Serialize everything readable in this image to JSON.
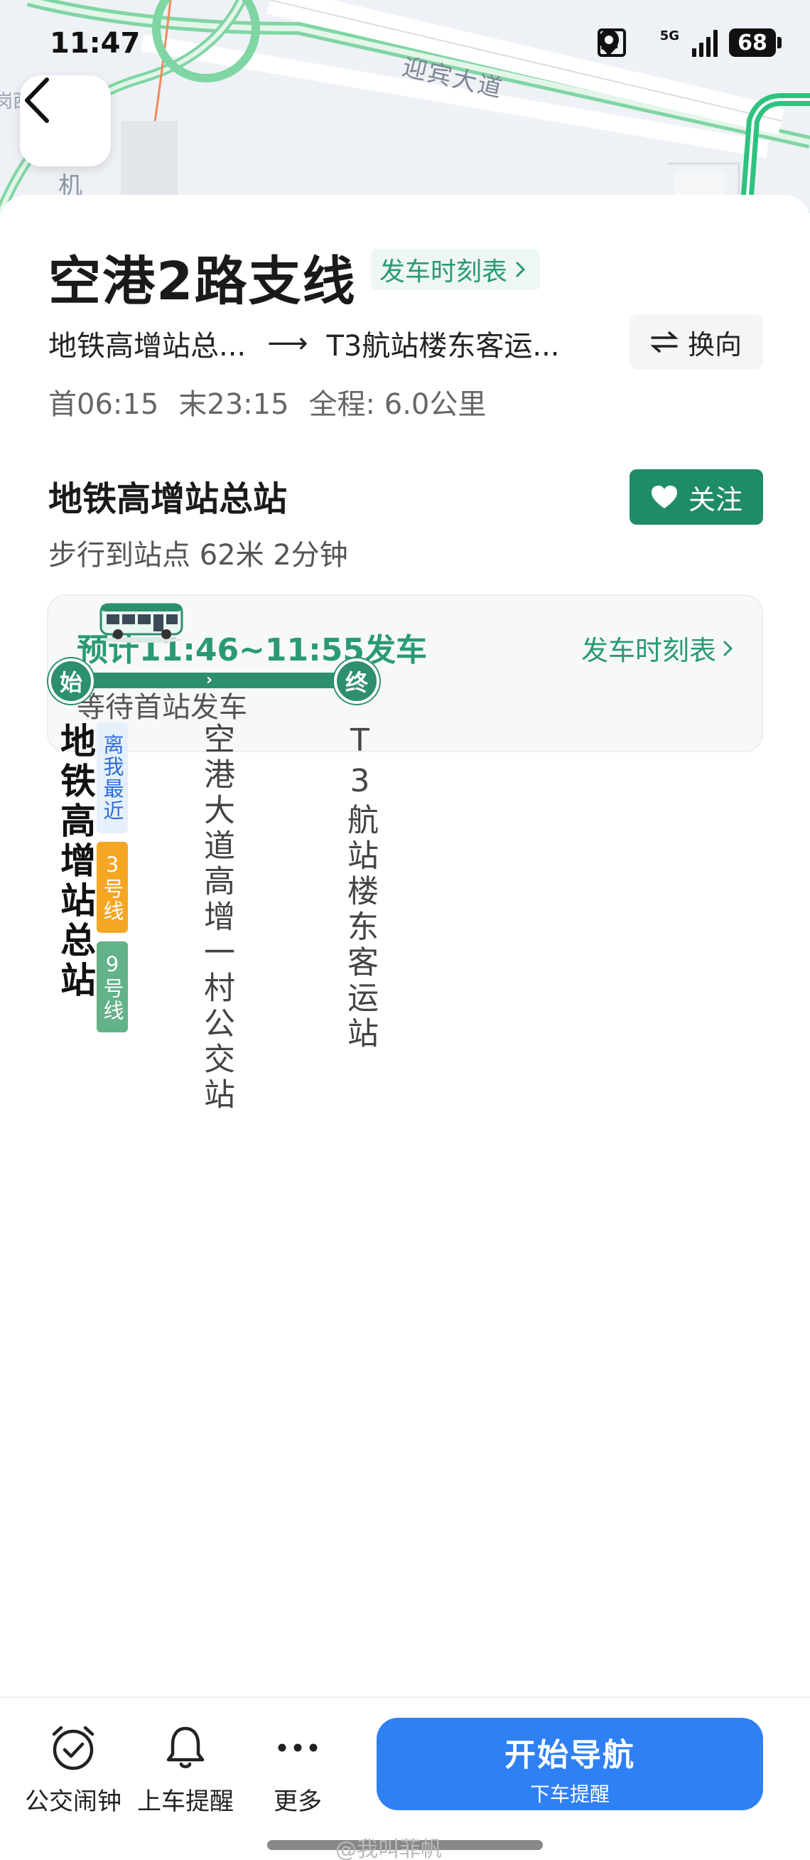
{
  "status_bar": {
    "time": "11:47",
    "network": "5G",
    "battery": "68"
  },
  "map": {
    "road_label": "迎宾大道",
    "map_char": "机",
    "map_char2": "岗西"
  },
  "header": {
    "title": "空港2路支线",
    "timetable_chip": "发车时刻表",
    "route_from": "地铁高增站总...",
    "route_arrow": "⟶",
    "route_to": "T3航站楼东客运...",
    "swap_label": "换向",
    "first_bus": "首06:15",
    "last_bus": "末23:15",
    "total_distance": "全程: 6.0公里"
  },
  "stop_info": {
    "name": "地铁高增站总站",
    "follow_label": "关注",
    "walk_info": "步行到站点 62米 2分钟"
  },
  "eta_card": {
    "eta": "预计11:46~11:55发车",
    "timetable_link": "发车时刻表",
    "status": "等待首站发车"
  },
  "diagram": {
    "start_node": "始",
    "end_node": "终",
    "stops": [
      "地铁高增站总站",
      "空港大道高增一村公交站",
      "T3航站楼东客运站"
    ],
    "tags": {
      "nearest": "离我最近",
      "line3": "3号线",
      "line9": "9号线"
    }
  },
  "bottom_bar": {
    "alarm_label": "公交闹钟",
    "reminder_label": "上车提醒",
    "more_label": "更多",
    "nav_label": "开始导航",
    "nav_sub": "下车提醒"
  },
  "watermark": "@我叫菲帆",
  "colors": {
    "accent_green": "#2a9a73",
    "route_green": "#2d8f6d",
    "nav_blue": "#2f80f5",
    "line3_orange": "#f5a623",
    "line9_green": "#62b28a",
    "nearest_blue": "#2f6fd6"
  }
}
